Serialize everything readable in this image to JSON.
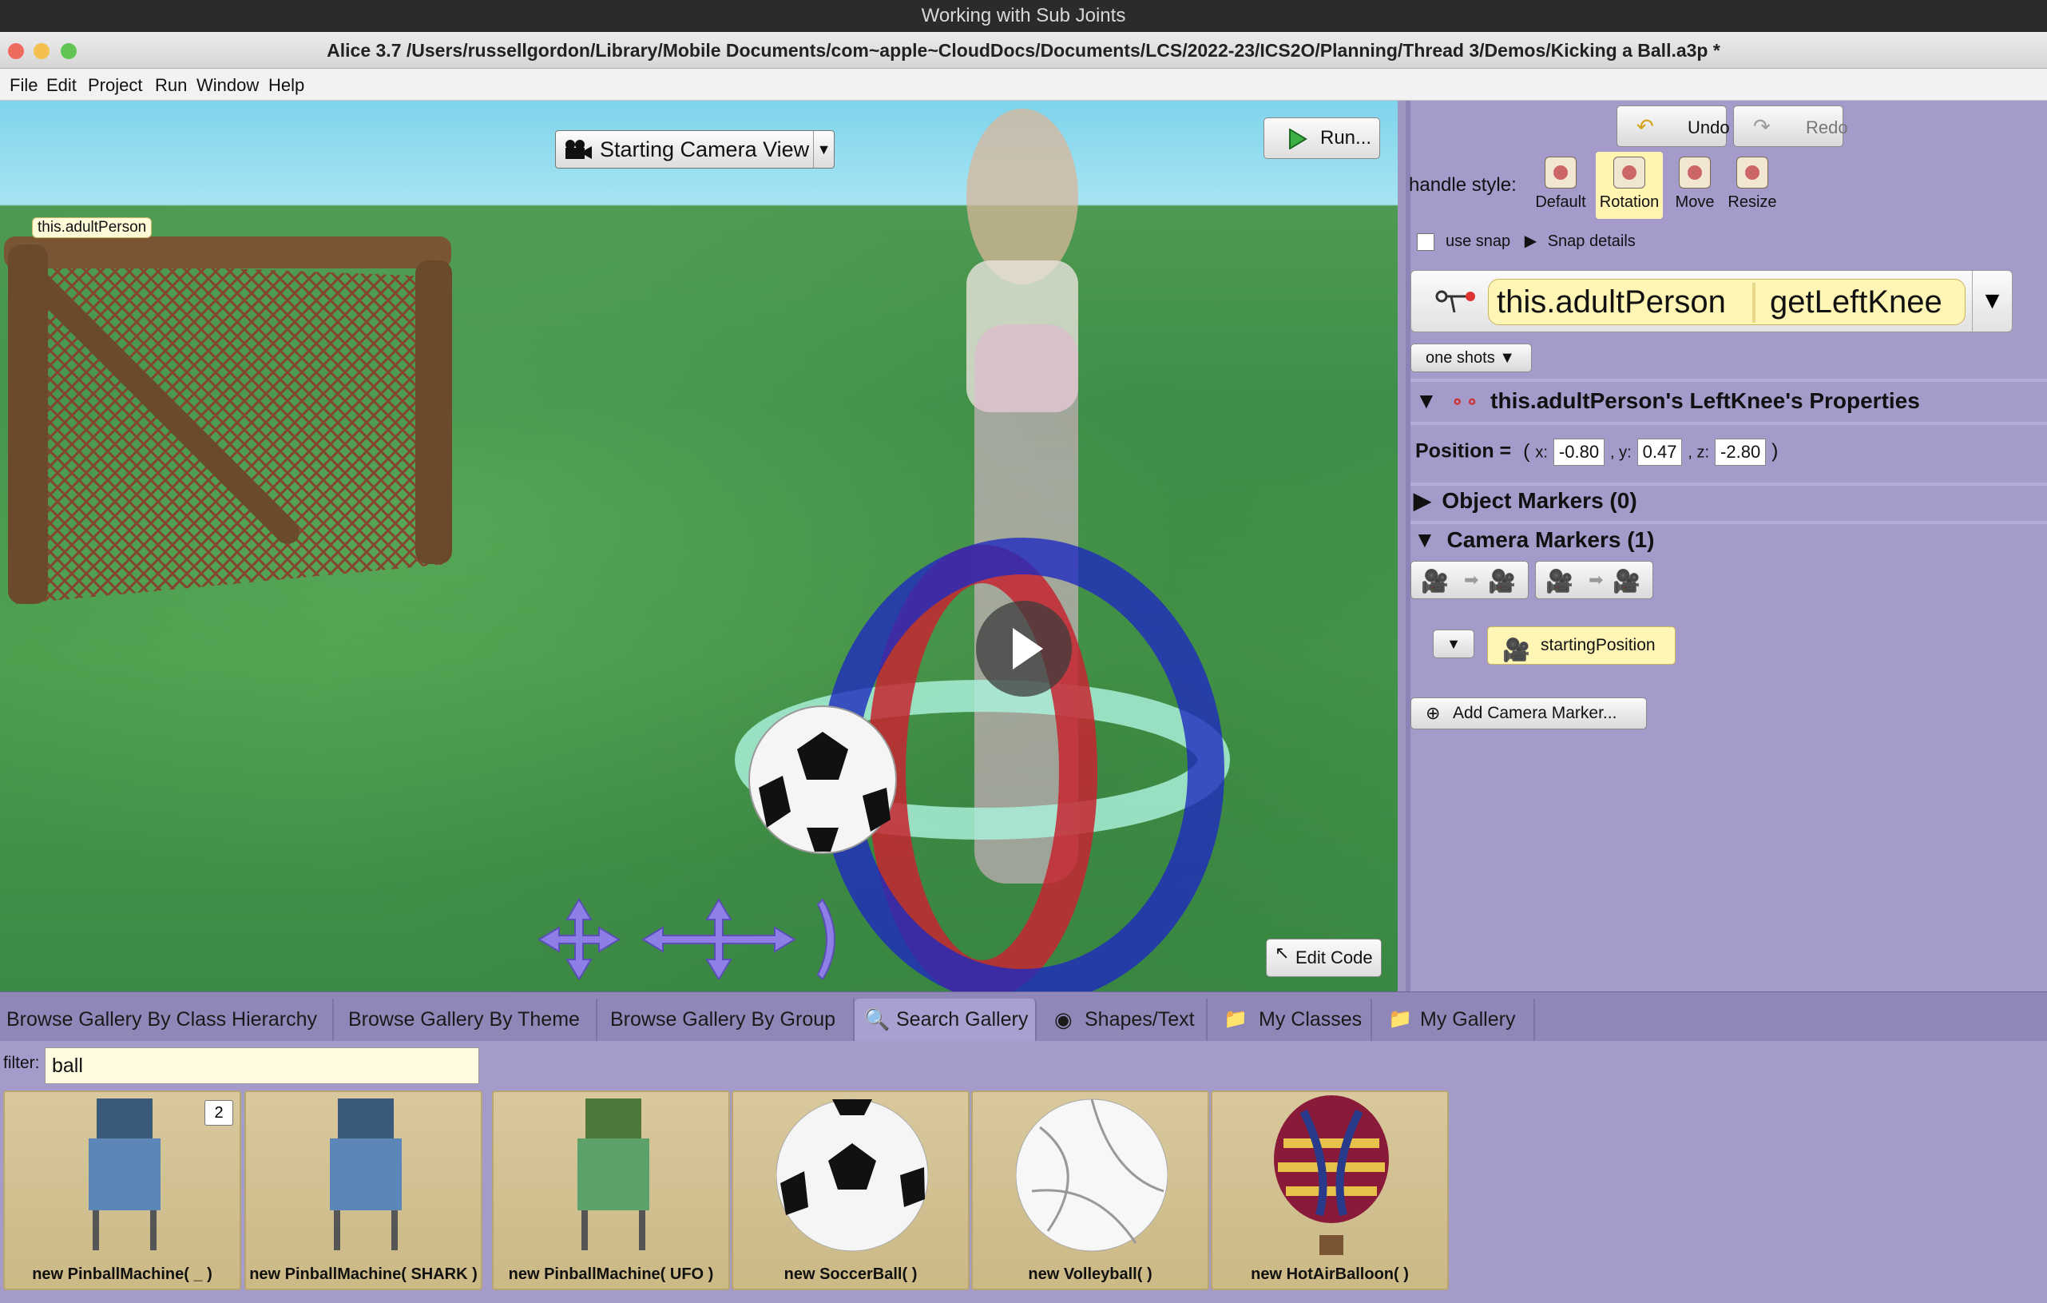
{
  "video_title": "Working with Sub Joints",
  "window": {
    "title": "Alice 3.7 /Users/russellgordon/Library/Mobile Documents/com~apple~CloudDocs/Documents/LCS/2022-23/ICS2O/Planning/Thread 3/Demos/Kicking a Ball.a3p *"
  },
  "menu": [
    "File",
    "Edit",
    "Project",
    "Run",
    "Window",
    "Help"
  ],
  "scene": {
    "camera_view": "Starting Camera View",
    "run_label": "Run...",
    "edit_code_label": "Edit Code",
    "labels": [
      "this.adultPerson"
    ]
  },
  "panel": {
    "undo": "Undo",
    "redo": "Redo",
    "handle_style_label": "handle style:",
    "handles": [
      "Default",
      "Rotation",
      "Move",
      "Resize"
    ],
    "active_handle": "Rotation",
    "use_snap": "use snap",
    "snap_details": "Snap details",
    "expr_object": "this.adultPerson",
    "expr_method": "getLeftKnee",
    "one_shots": "one shots",
    "properties_title": "this.adultPerson's LeftKnee's Properties",
    "position_label": "Position =",
    "position": {
      "x": "-0.80",
      "y": "0.47",
      "z": "-2.80"
    },
    "object_markers": "Object Markers (0)",
    "camera_markers": "Camera Markers (1)",
    "marker_name": "startingPosition",
    "add_camera_marker": "Add Camera Marker..."
  },
  "gallery": {
    "tabs": [
      "Browse Gallery By Class Hierarchy",
      "Browse Gallery By Theme",
      "Browse Gallery By Group",
      "Search Gallery",
      "Shapes/Text",
      "My Classes",
      "My Gallery"
    ],
    "active_tab": "Search Gallery",
    "filter_label": "filter:",
    "filter_value": "ball",
    "items": [
      {
        "label": "new PinballMachine( _ )",
        "badge": "2"
      },
      {
        "label": "new PinballMachine( SHARK )"
      },
      {
        "label": "new PinballMachine( UFO )"
      },
      {
        "label": "new SoccerBall( )"
      },
      {
        "label": "new Volleyball( )"
      },
      {
        "label": "new HotAirBalloon( )"
      }
    ]
  },
  "colors": {
    "panel_bg": "#a49bcb",
    "pill": "#fff5b5",
    "ground": "#3f8e48",
    "sky": "#7fd4ec"
  }
}
